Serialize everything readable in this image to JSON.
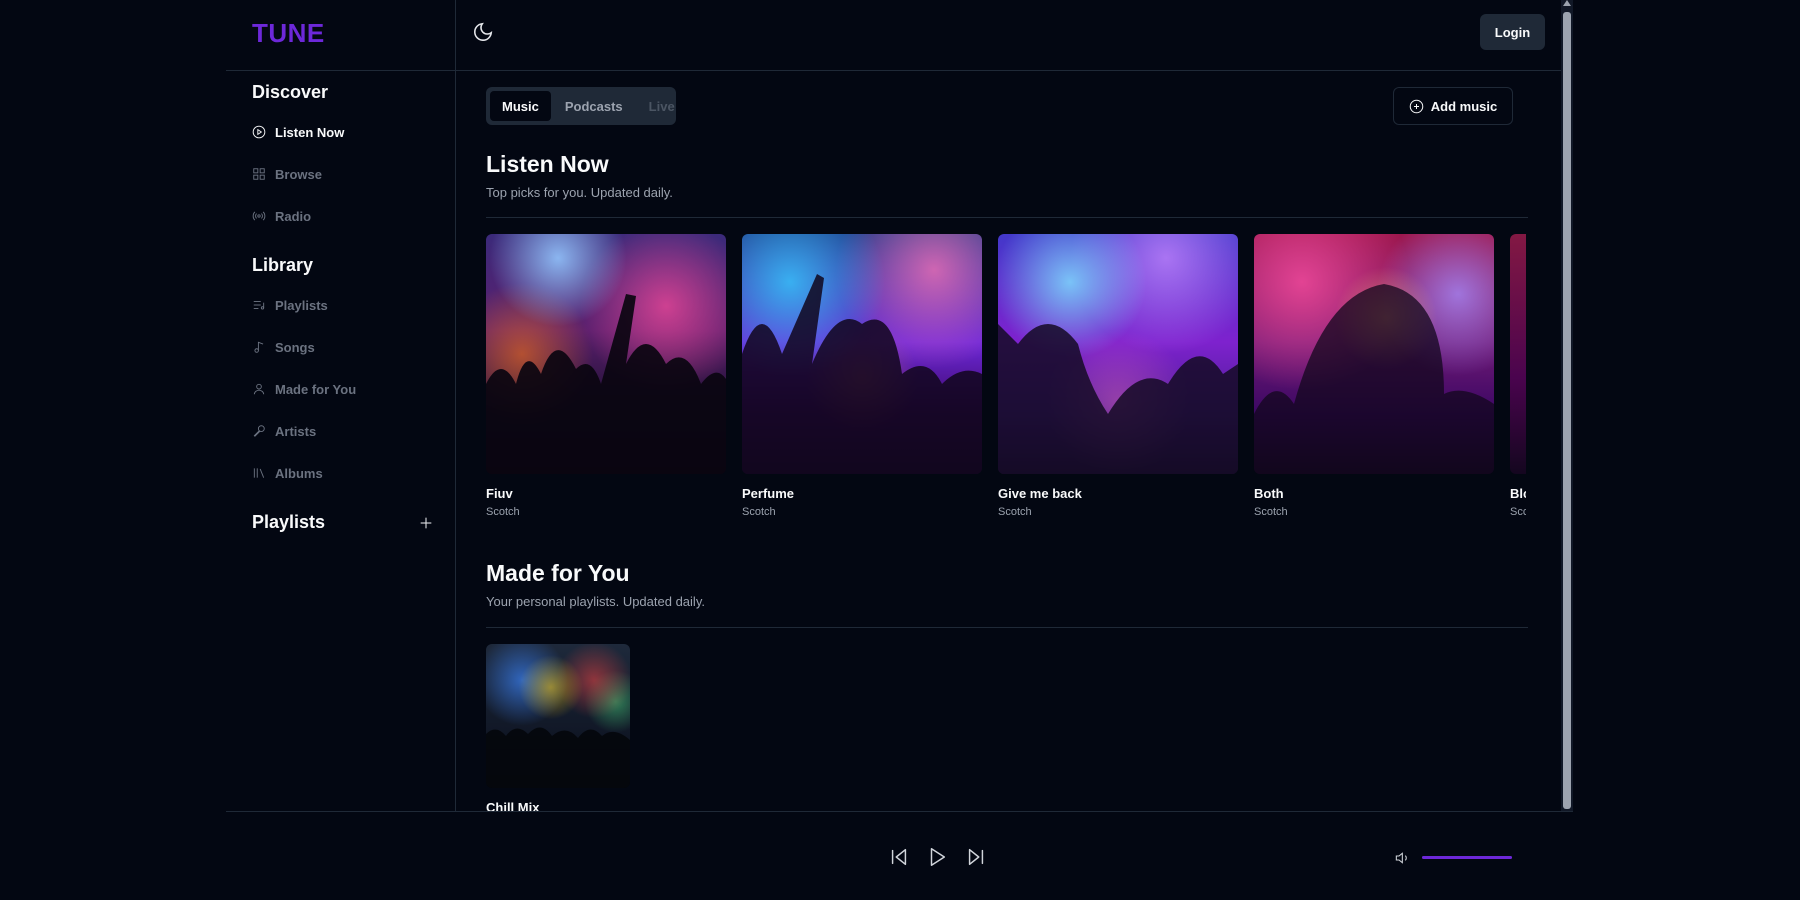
{
  "app": {
    "logo": "TUNE",
    "colors": {
      "accent": "#6d28d9",
      "background": "#030712",
      "border": "#1f2937"
    }
  },
  "sidebar": {
    "discover_title": "Discover",
    "discover_items": [
      {
        "label": "Listen Now",
        "icon": "play-circle-icon",
        "active": true
      },
      {
        "label": "Browse",
        "icon": "grid-icon",
        "active": false
      },
      {
        "label": "Radio",
        "icon": "radio-icon",
        "active": false
      }
    ],
    "library_title": "Library",
    "library_items": [
      {
        "label": "Playlists",
        "icon": "list-music-icon"
      },
      {
        "label": "Songs",
        "icon": "music-note-icon"
      },
      {
        "label": "Made for You",
        "icon": "user-icon"
      },
      {
        "label": "Artists",
        "icon": "microphone-icon"
      },
      {
        "label": "Albums",
        "icon": "library-icon"
      }
    ],
    "playlists_title": "Playlists"
  },
  "header": {
    "theme_toggle_icon": "moon-icon",
    "login_label": "Login"
  },
  "main": {
    "tabs": [
      {
        "label": "Music",
        "state": "active"
      },
      {
        "label": "Podcasts",
        "state": "normal"
      },
      {
        "label": "Live",
        "state": "disabled"
      }
    ],
    "add_music_label": "Add music",
    "listen_now": {
      "title": "Listen Now",
      "subtitle": "Top picks for you. Updated daily.",
      "items": [
        {
          "title": "Fiuv",
          "artist": "Scotch"
        },
        {
          "title": "Perfume",
          "artist": "Scotch"
        },
        {
          "title": "Give me back",
          "artist": "Scotch"
        },
        {
          "title": "Both",
          "artist": "Scotch"
        },
        {
          "title": "Blc",
          "artist": "Scc"
        }
      ]
    },
    "made_for_you": {
      "title": "Made for You",
      "subtitle": "Your personal playlists. Updated daily.",
      "items": [
        {
          "title": "Chill Mix"
        }
      ]
    }
  },
  "player": {
    "controls": [
      "skip-back-icon",
      "play-icon",
      "skip-forward-icon"
    ],
    "volume_icon": "volume-icon",
    "volume_level": 1.0
  }
}
